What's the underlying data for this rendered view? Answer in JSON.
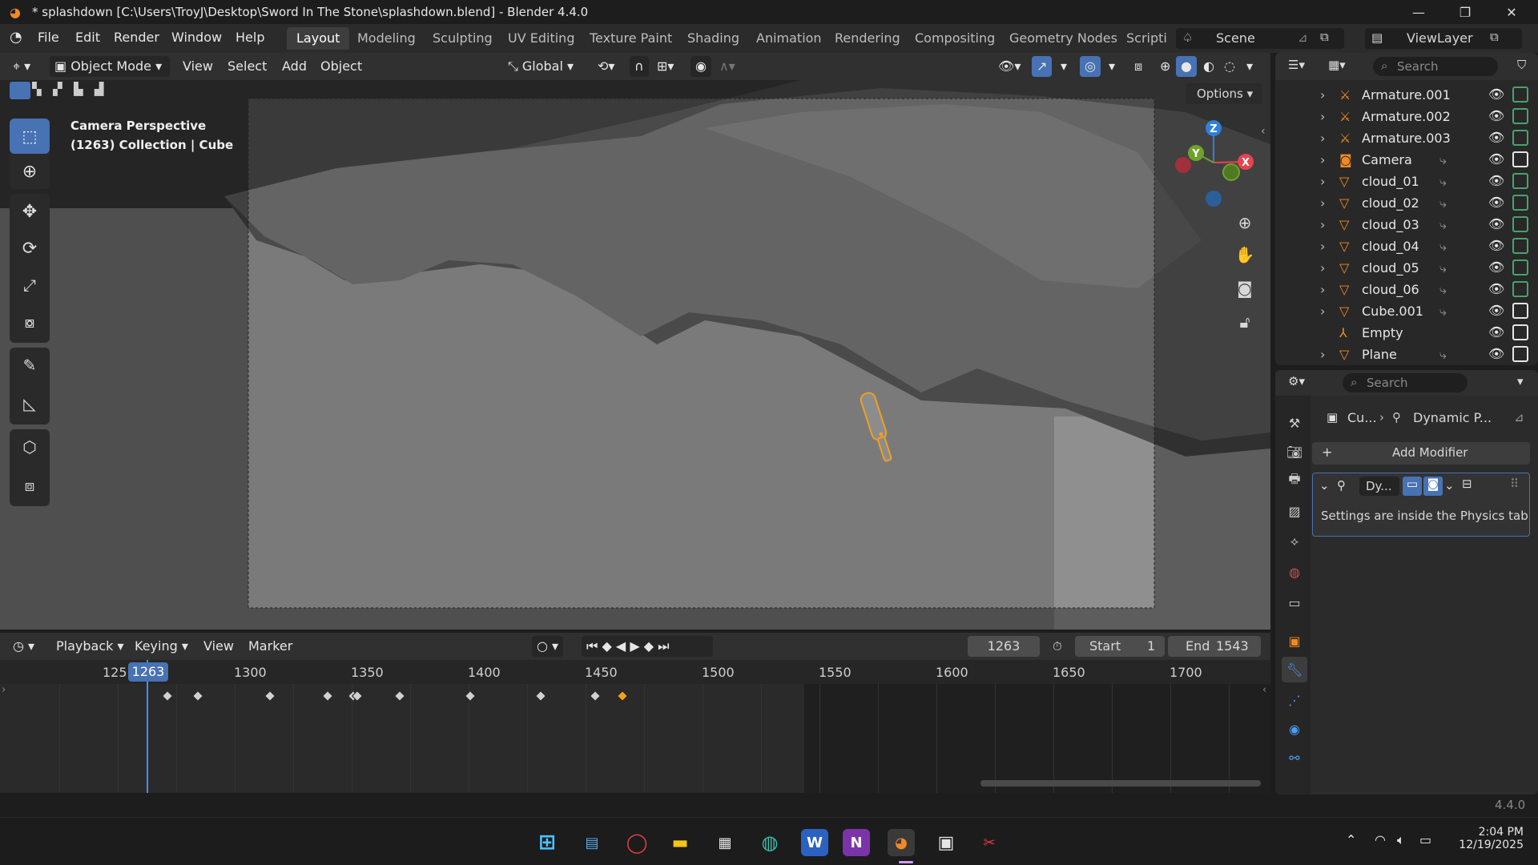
{
  "window": {
    "title": "* splashdown [C:\\Users\\TroyJ\\Desktop\\Sword In The Stone\\splashdown.blend] - Blender 4.4.0"
  },
  "menu": [
    "File",
    "Edit",
    "Render",
    "Window",
    "Help"
  ],
  "workspaces": [
    "Layout",
    "Modeling",
    "Sculpting",
    "UV Editing",
    "Texture Paint",
    "Shading",
    "Animation",
    "Rendering",
    "Compositing",
    "Geometry Nodes",
    "Scripti"
  ],
  "scene_name": "Scene",
  "view_layer": "ViewLayer",
  "viewport_header": {
    "mode": "Object Mode",
    "view": "View",
    "select": "Select",
    "add": "Add",
    "object": "Object",
    "orientation": "Global",
    "options": "Options"
  },
  "viewport": {
    "overlay_line1": "Camera Perspective",
    "overlay_line2": "(1263) Collection | Cube",
    "axis_z": "Z",
    "axis_y": "Y",
    "axis_x": "X"
  },
  "outliner": {
    "search_placeholder": "Search",
    "items": [
      {
        "name": "Armature.001",
        "type": "armature-icon",
        "chevron": true,
        "modifier": false,
        "cam_white": false
      },
      {
        "name": "Armature.002",
        "type": "armature-icon",
        "chevron": true,
        "modifier": false,
        "cam_white": false
      },
      {
        "name": "Armature.003",
        "type": "armature-icon",
        "chevron": true,
        "modifier": false,
        "cam_white": false
      },
      {
        "name": "Camera",
        "type": "camera-icon",
        "chevron": true,
        "modifier": true,
        "cam_white": true
      },
      {
        "name": "cloud_01",
        "type": "mesh-icon",
        "chevron": true,
        "modifier": true,
        "cam_white": false
      },
      {
        "name": "cloud_02",
        "type": "mesh-icon",
        "chevron": true,
        "modifier": true,
        "cam_white": false
      },
      {
        "name": "cloud_03",
        "type": "mesh-icon",
        "chevron": true,
        "modifier": true,
        "cam_white": false
      },
      {
        "name": "cloud_04",
        "type": "mesh-icon",
        "chevron": true,
        "modifier": true,
        "cam_white": false
      },
      {
        "name": "cloud_05",
        "type": "mesh-icon",
        "chevron": true,
        "modifier": true,
        "cam_white": false
      },
      {
        "name": "cloud_06",
        "type": "mesh-icon",
        "chevron": true,
        "modifier": true,
        "cam_white": false
      },
      {
        "name": "Cube.001",
        "type": "mesh-icon",
        "chevron": true,
        "modifier": true,
        "cam_white": true
      },
      {
        "name": "Empty",
        "type": "empty-icon",
        "chevron": false,
        "modifier": false,
        "cam_white": true
      },
      {
        "name": "Plane",
        "type": "mesh-icon",
        "chevron": true,
        "modifier": true,
        "cam_white": true
      }
    ]
  },
  "properties": {
    "search_placeholder": "Search",
    "breadcrumb_object": "Cu...",
    "breadcrumb_modifier": "Dynamic P...",
    "add_modifier": "Add Modifier",
    "modifier_name": "Dy...",
    "modifier_note": "Settings are inside the Physics tab"
  },
  "timeline": {
    "playback": "Playback",
    "keying": "Keying",
    "view": "View",
    "marker": "Marker",
    "current_frame": "1263",
    "start_label": "Start",
    "start_value": "1",
    "end_label": "End",
    "end_value": "1543",
    "ruler_labels": [
      "125",
      "1300",
      "1350",
      "1400",
      "1450",
      "1500",
      "1550",
      "1600",
      "1650",
      "1700"
    ],
    "playhead_label": "1263"
  },
  "status": {
    "version": "4.4.0"
  },
  "taskbar": {
    "time": "2:04 PM",
    "date": "12/19/2025"
  },
  "colors": {
    "accent": "#4772b3",
    "selection_outline": "#f0a020",
    "axis_x": "#e8434e",
    "axis_y": "#6fa22b",
    "axis_z": "#2f80d8"
  }
}
